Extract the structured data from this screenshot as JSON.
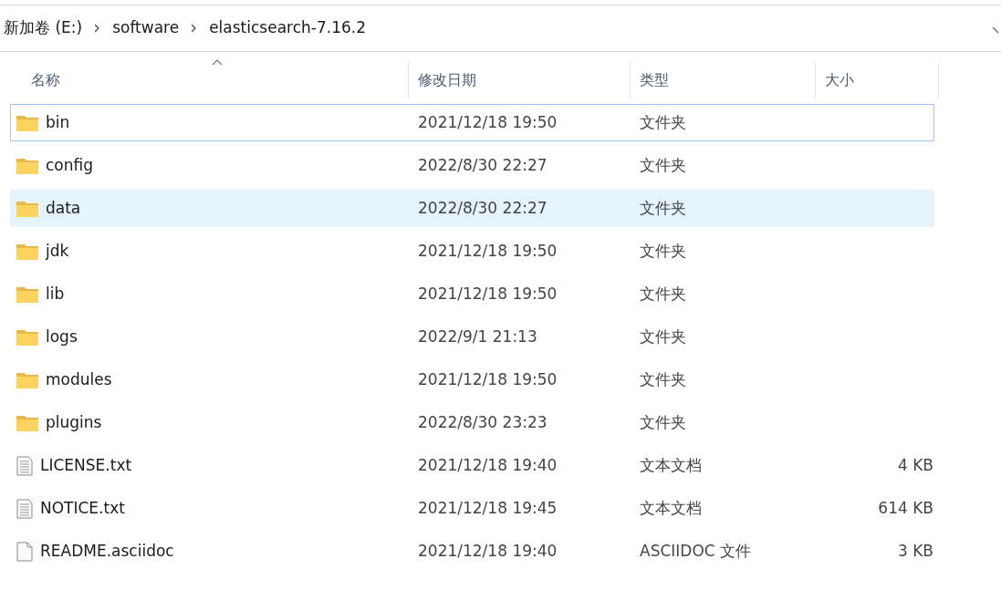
{
  "breadcrumb": [
    {
      "label": "新加卷 (E:)"
    },
    {
      "label": "software"
    },
    {
      "label": "elasticsearch-7.16.2"
    }
  ],
  "columns": [
    {
      "label": "名称",
      "sorted": true
    },
    {
      "label": "修改日期",
      "sorted": false
    },
    {
      "label": "类型",
      "sorted": false
    },
    {
      "label": "大小",
      "sorted": false
    }
  ],
  "rows": [
    {
      "kind": "folder",
      "name": "bin",
      "modified": "2021/12/18 19:50",
      "type": "文件夹",
      "focused": true,
      "selected": false
    },
    {
      "kind": "folder",
      "name": "config",
      "modified": "2022/8/30 22:27",
      "type": "文件夹",
      "focused": false,
      "selected": false
    },
    {
      "kind": "folder",
      "name": "data",
      "modified": "2022/8/30 22:27",
      "type": "文件夹",
      "focused": false,
      "selected": true
    },
    {
      "kind": "folder",
      "name": "jdk",
      "modified": "2021/12/18 19:50",
      "type": "文件夹",
      "focused": false,
      "selected": false
    },
    {
      "kind": "folder",
      "name": "lib",
      "modified": "2021/12/18 19:50",
      "type": "文件夹",
      "focused": false,
      "selected": false
    },
    {
      "kind": "folder",
      "name": "logs",
      "modified": "2022/9/1 21:13",
      "type": "文件夹",
      "focused": false,
      "selected": false
    },
    {
      "kind": "folder",
      "name": "modules",
      "modified": "2021/12/18 19:50",
      "type": "文件夹",
      "focused": false,
      "selected": false
    },
    {
      "kind": "folder",
      "name": "plugins",
      "modified": "2022/8/30 23:23",
      "type": "文件夹",
      "focused": false,
      "selected": false
    },
    {
      "kind": "text",
      "name": "LICENSE.txt",
      "modified": "2021/12/18 19:40",
      "type": "文本文档",
      "size": "4 KB",
      "focused": false,
      "selected": false
    },
    {
      "kind": "text",
      "name": "NOTICE.txt",
      "modified": "2021/12/18 19:45",
      "type": "文本文档",
      "size": "614 KB",
      "focused": false,
      "selected": false
    },
    {
      "kind": "file",
      "name": "README.asciidoc",
      "modified": "2021/12/18 19:40",
      "type": "ASCIIDOC 文件",
      "size": "3 KB",
      "focused": false,
      "selected": false
    }
  ]
}
